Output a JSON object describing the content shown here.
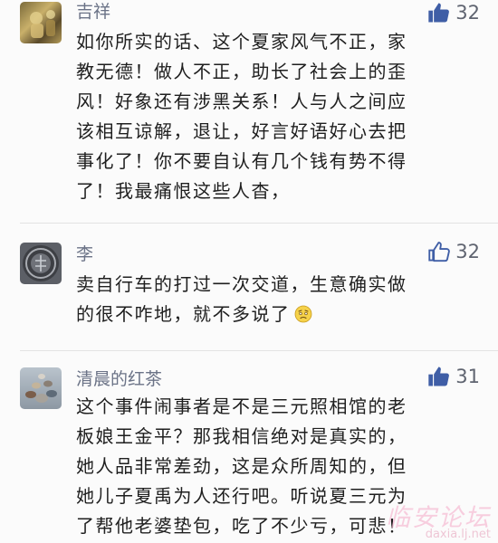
{
  "comments": [
    {
      "user": "吉祥",
      "likes": "32",
      "like_style": "filled",
      "avatar_icon": "gold-statue-avatar",
      "lines": [
        "如你所实的话、这个夏家风气不正，家",
        "教无德！做人不正，助长了社会上的歪",
        "风！好象还有涉黑关系！人与人之间应",
        "该相互谅解，退让，好言好语好心去把",
        "事化了！你不要自认有几个钱有势不得",
        "了！我最痛恨这些人杳，"
      ]
    },
    {
      "user": "李",
      "likes": "32",
      "like_style": "outline",
      "avatar_icon": "coin-avatar",
      "lines": [
        "卖自行车的打过一次交道，生意确实做",
        "的很不咋地，就不多说了"
      ],
      "emoji": "worried-face-emoji"
    },
    {
      "user": "清晨的红茶",
      "likes": "31",
      "like_style": "filled",
      "avatar_icon": "pebbles-avatar",
      "lines": [
        "这个事件闹事者是不是三元照相馆的老",
        "板娘王金平？那我相信绝对是真实的，",
        "她人品非常差劲，这是众所周知的，但",
        "她儿子夏禹为人还行吧。听说夏三元为",
        "了帮他老婆垫包，吃了不少亏，可悲！"
      ]
    }
  ],
  "watermark": {
    "title": "临安论坛",
    "url": "daxia.lj.net"
  },
  "colors": {
    "username": "#6b7387",
    "like_icon": "#3f5ea6",
    "background": "#fbfbfb"
  }
}
